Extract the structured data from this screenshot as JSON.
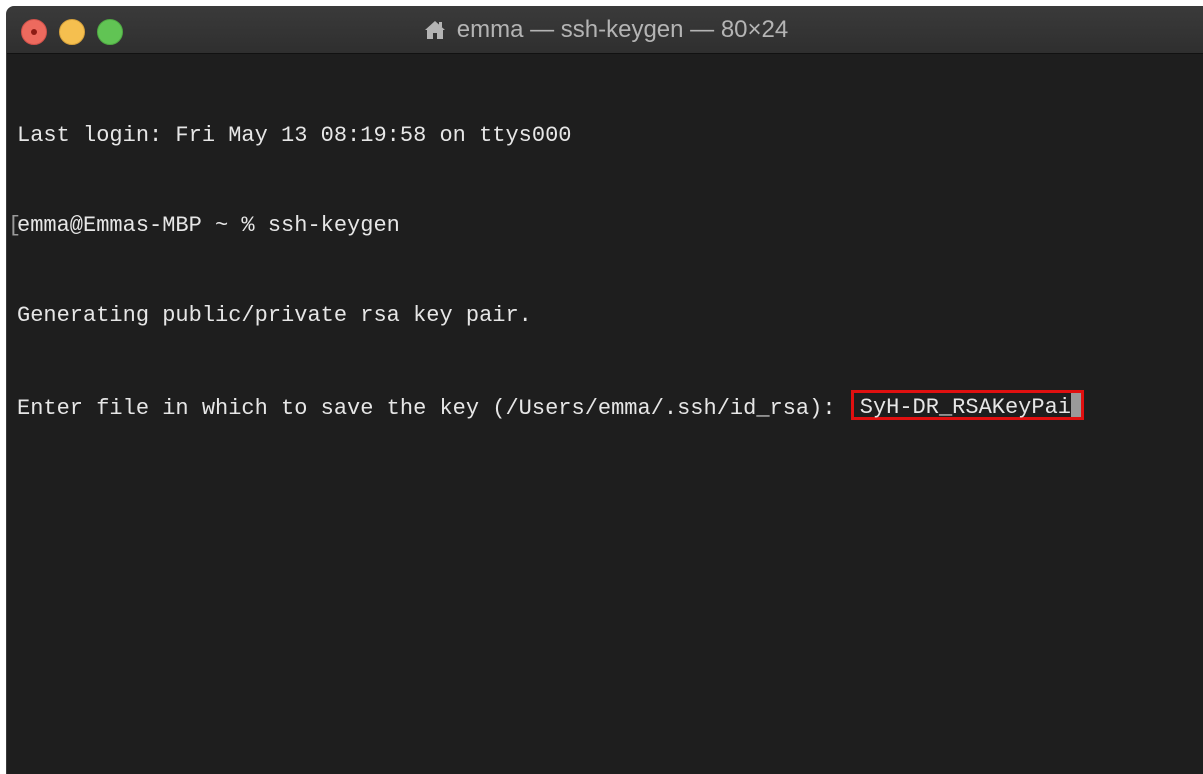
{
  "window": {
    "title": "emma — ssh-keygen — 80×24",
    "title_icon": "home-icon"
  },
  "terminal": {
    "lines": [
      "Last login: Fri May 13 08:19:58 on ttys000",
      "emma@Emmas-MBP ~ % ssh-keygen",
      "Generating public/private rsa key pair.",
      "Enter file in which to save the key (/Users/emma/.ssh/id_rsa): "
    ],
    "typed_input": "SyH-DR_RSAKeyPai",
    "highlight_color": "#e01010"
  }
}
